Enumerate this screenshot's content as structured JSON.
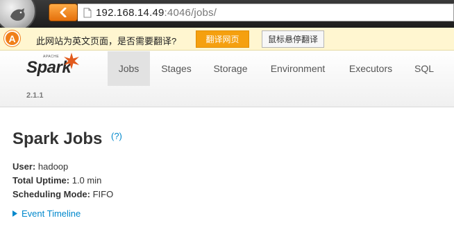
{
  "browser": {
    "url_host": "192.168.14.49",
    "url_rest": ":4046/jobs/"
  },
  "translate_bar": {
    "icon_letter": "A",
    "message": "此网站为英文页面，是否需要翻译?",
    "translate_button": "翻译网页",
    "no_translate_button": "鼠标悬停翻译"
  },
  "navbar": {
    "logo_small_text": "APACHE",
    "logo_text": "Spark",
    "version": "2.1.1",
    "tabs": [
      {
        "label": "Jobs",
        "active": true
      },
      {
        "label": "Stages",
        "active": false
      },
      {
        "label": "Storage",
        "active": false
      },
      {
        "label": "Environment",
        "active": false
      },
      {
        "label": "Executors",
        "active": false
      },
      {
        "label": "SQL",
        "active": false
      }
    ]
  },
  "page": {
    "title": "Spark Jobs",
    "help_link": "(?)",
    "summary": [
      {
        "label": "User:",
        "value": "hadoop"
      },
      {
        "label": "Total Uptime:",
        "value": "1.0 min"
      },
      {
        "label": "Scheduling Mode:",
        "value": "FIFO"
      }
    ],
    "event_timeline_label": "Event Timeline"
  },
  "colors": {
    "spark_orange": "#e25a1c",
    "link_blue": "#0088cc",
    "translate_orange": "#f5a00f",
    "active_tab_bg": "#e2e2e2"
  }
}
